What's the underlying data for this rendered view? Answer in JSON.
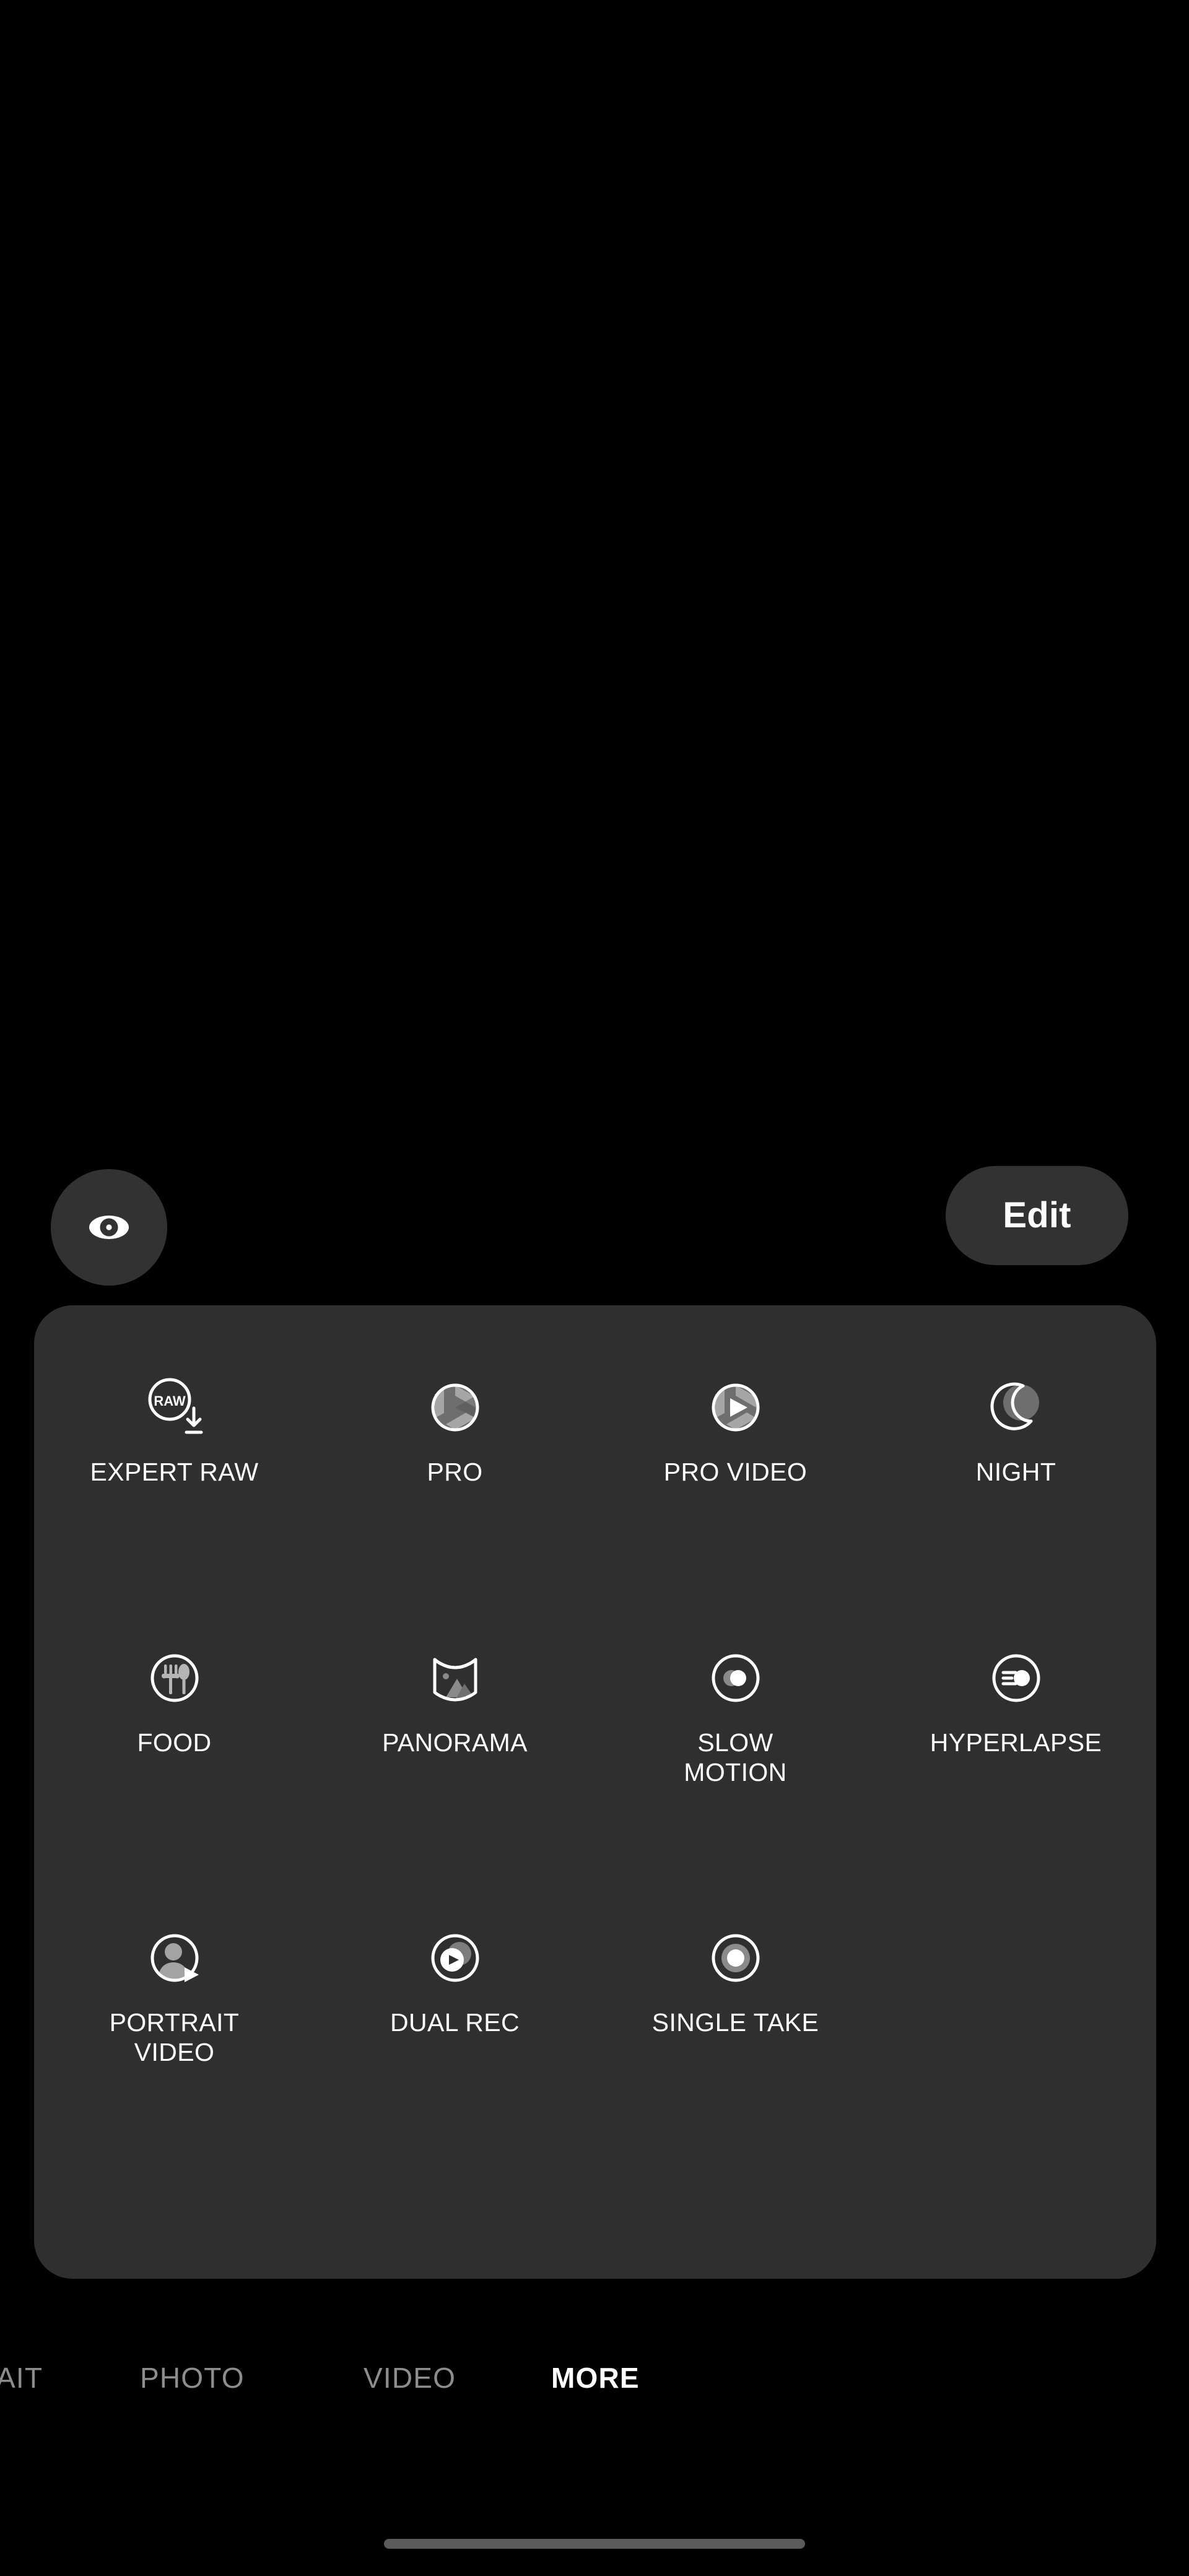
{
  "app": {
    "name": "Camera",
    "screen": "More camera modes"
  },
  "colors": {
    "background": "#000000",
    "panel": "#2f2f2f",
    "button": "#323232",
    "text_primary": "#ffffff",
    "text_inactive": "#8d8d8d",
    "icon_fill_grey": "#8a8a8a",
    "home_indicator": "#5a5a5a"
  },
  "overlay": {
    "preview_toggle": {
      "icon": "eye-icon",
      "label": ""
    },
    "edit_button": {
      "label": "Edit",
      "icon": ""
    }
  },
  "more_panel": {
    "rows": [
      [
        {
          "label": "EXPERT RAW",
          "icon": "expert-raw-icon"
        },
        {
          "label": "PRO",
          "icon": "aperture-icon"
        },
        {
          "label": "PRO VIDEO",
          "icon": "aperture-play-icon"
        },
        {
          "label": "NIGHT",
          "icon": "moon-icon"
        }
      ],
      [
        {
          "label": "FOOD",
          "icon": "fork-spoon-icon"
        },
        {
          "label": "PANORAMA",
          "icon": "panorama-icon"
        },
        {
          "label": "SLOW\nMOTION",
          "icon": "slow-motion-icon"
        },
        {
          "label": "HYPERLAPSE",
          "icon": "hyperlapse-icon"
        }
      ],
      [
        {
          "label": "PORTRAIT\nVIDEO",
          "icon": "portrait-video-icon"
        },
        {
          "label": "DUAL REC",
          "icon": "dual-rec-icon"
        },
        {
          "label": "SINGLE TAKE",
          "icon": "single-take-icon"
        },
        {
          "label": "",
          "icon": ""
        }
      ]
    ]
  },
  "mode_strip": {
    "items": [
      {
        "label": "AIT",
        "active": false
      },
      {
        "label": "PHOTO",
        "active": false
      },
      {
        "label": "VIDEO",
        "active": false
      },
      {
        "label": "MORE",
        "active": true
      }
    ]
  }
}
